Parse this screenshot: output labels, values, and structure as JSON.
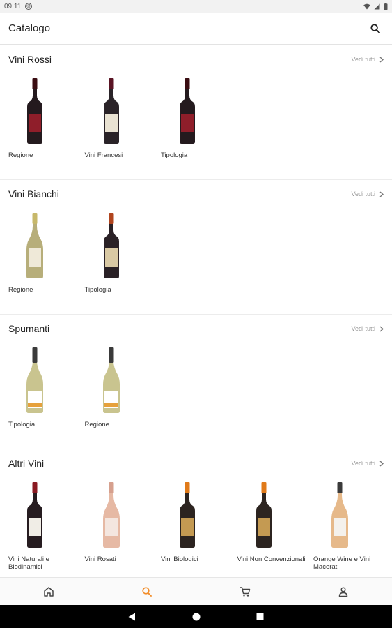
{
  "status_bar": {
    "time": "09:11"
  },
  "app_bar": {
    "title": "Catalogo"
  },
  "sections": [
    {
      "title": "Vini Rossi",
      "see_all": "Vedi tutti",
      "items": [
        {
          "label": "Regione",
          "bottle": {
            "kind": "red",
            "glass": "#241a1e",
            "label": "#8f1e2a",
            "cap": "#3a0d12"
          }
        },
        {
          "label": "Vini Francesi",
          "bottle": {
            "kind": "red",
            "glass": "#2a2328",
            "label": "#e9e2d2",
            "cap": "#5a1424"
          }
        },
        {
          "label": "Tipologia",
          "bottle": {
            "kind": "red",
            "glass": "#241a1e",
            "label": "#8f1e2a",
            "cap": "#3a0d12"
          }
        }
      ]
    },
    {
      "title": "Vini Bianchi",
      "see_all": "Vedi tutti",
      "items": [
        {
          "label": "Regione",
          "bottle": {
            "kind": "white",
            "glass": "#b7ae7a",
            "label": "#efe9d8",
            "cap": "#c7b86a"
          }
        },
        {
          "label": "Tipologia",
          "bottle": {
            "kind": "red",
            "glass": "#2a2126",
            "label": "#d9c9a4",
            "cap": "#b0441e"
          }
        }
      ]
    },
    {
      "title": "Spumanti",
      "see_all": "Vedi tutti",
      "items": [
        {
          "label": "Tipologia",
          "bottle": {
            "kind": "sparkling",
            "glass": "#c9c48f",
            "label": "#ffffff",
            "cap": "#3a3a3a"
          }
        },
        {
          "label": "Regione",
          "bottle": {
            "kind": "sparkling",
            "glass": "#c9c48f",
            "label": "#ffffff",
            "cap": "#3a3a3a"
          }
        }
      ]
    },
    {
      "title": "Altri Vini",
      "see_all": "Vedi tutti",
      "items": [
        {
          "label": "Vini Naturali e Biodinamici",
          "bottle": {
            "kind": "red",
            "glass": "#261c20",
            "label": "#f0ede6",
            "cap": "#8a1a22"
          }
        },
        {
          "label": "Vini Rosati",
          "bottle": {
            "kind": "rose",
            "glass": "#e6b9a4",
            "label": "#f4e6df",
            "cap": "#d6a08e"
          }
        },
        {
          "label": "Vini Biologici",
          "bottle": {
            "kind": "red",
            "glass": "#2c2420",
            "label": "#c49a52",
            "cap": "#e07a1a"
          }
        },
        {
          "label": "Vini Non Convenzionali",
          "bottle": {
            "kind": "red",
            "glass": "#2c2420",
            "label": "#c49a52",
            "cap": "#e07a1a"
          }
        },
        {
          "label": "Orange Wine e Vini Macerati",
          "bottle": {
            "kind": "orange",
            "glass": "#e6b98a",
            "label": "#f4f1ec",
            "cap": "#3a3a3a"
          }
        }
      ]
    }
  ],
  "bottom_nav": [
    {
      "name": "home",
      "icon": "home-icon",
      "active": false
    },
    {
      "name": "search",
      "icon": "search-icon",
      "active": true
    },
    {
      "name": "cart",
      "icon": "cart-icon",
      "active": false
    },
    {
      "name": "profile",
      "icon": "person-icon",
      "active": false
    }
  ],
  "colors": {
    "accent": "#f28c28",
    "nav_inactive": "#444444"
  }
}
